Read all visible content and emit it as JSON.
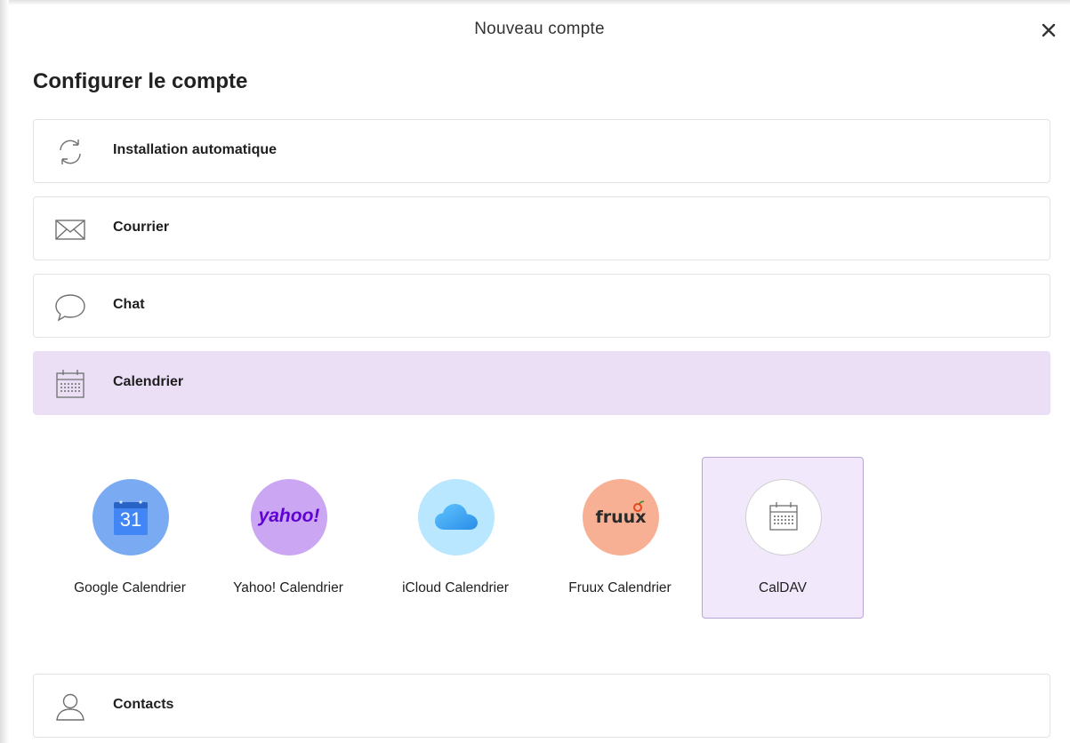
{
  "window": {
    "title": "Nouveau compte"
  },
  "page": {
    "title": "Configurer le compte"
  },
  "options": [
    {
      "label": "Installation automatique",
      "icon": "sync-icon"
    },
    {
      "label": "Courrier",
      "icon": "mail-icon"
    },
    {
      "label": "Chat",
      "icon": "chat-bubble-icon"
    },
    {
      "label": "Calendrier",
      "icon": "calendar-icon",
      "selected": true
    },
    {
      "label": "Contacts",
      "icon": "person-icon"
    }
  ],
  "providers": [
    {
      "label": "Google Calendrier",
      "icon": "google-calendar-icon",
      "logo_text": "31"
    },
    {
      "label": "Yahoo! Calendrier",
      "icon": "yahoo-logo-icon",
      "logo_text": "yahoo!"
    },
    {
      "label": "iCloud Calendrier",
      "icon": "icloud-icon"
    },
    {
      "label": "Fruux Calendrier",
      "icon": "fruux-logo-icon",
      "logo_text": "fruux"
    },
    {
      "label": "CalDAV",
      "icon": "calendar-icon",
      "selected": true
    }
  ],
  "colors": {
    "selected_row_bg": "#ebdff6",
    "selected_tile_bg": "#f1e8fb",
    "selected_tile_border": "#b9a6d6",
    "google": "#7aaaf2",
    "yahoo": "#caa6f3",
    "icloud": "#b8e7ff",
    "fruux": "#f7b094"
  }
}
